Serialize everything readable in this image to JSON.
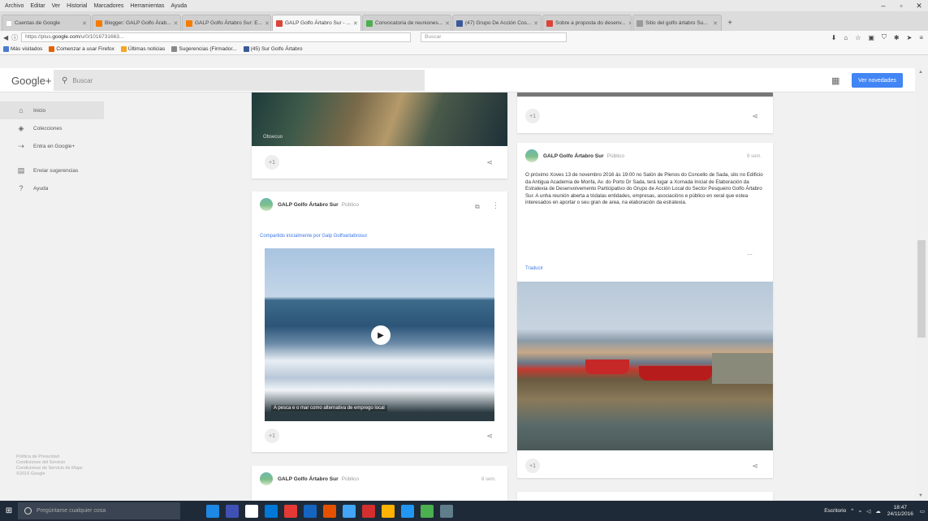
{
  "browser": {
    "menu": [
      "Archivo",
      "Editar",
      "Ver",
      "Historial",
      "Marcadores",
      "Herramientas",
      "Ayuda"
    ],
    "tabs": [
      {
        "title": "Cuentas de Google",
        "color": "#ffffff"
      },
      {
        "title": "Blogger: GALP Golfo Árab...",
        "color": "#f57c00"
      },
      {
        "title": "GALP Golfo Ártabro Sur: E...",
        "color": "#f57c00"
      },
      {
        "title": "GALP Golfo Ártabro Sur - ...",
        "color": "#db4437",
        "active": true
      },
      {
        "title": "Convocatoria de reuniones...",
        "color": "#4caf50"
      },
      {
        "title": "(47) Grupo De Acción Cos...",
        "color": "#3b5998"
      },
      {
        "title": "Sobre a proposta do desenv...",
        "color": "#db4437"
      },
      {
        "title": "Sitio del golfo ártabro Su...",
        "color": "#999999"
      }
    ],
    "url_prefix": "https://plus.",
    "url_domain": "google.com",
    "url_path": "/u/0/1016731663...",
    "search_placeholder": "Buscar",
    "bookmarks": [
      {
        "label": "Más visitados",
        "color": "#4a7bd0"
      },
      {
        "label": "Comenzar a usar Firefox",
        "color": "#e66000"
      },
      {
        "label": "Últimas noticias",
        "color": "#f5a623"
      },
      {
        "label": "Sugerencias (Firmador...",
        "color": "#888888"
      },
      {
        "label": "(45) Sur Golfo Ártabro",
        "color": "#3b5998"
      }
    ]
  },
  "gplus": {
    "logo": "Google+",
    "search_placeholder": "Buscar",
    "notifications_button": "Ver novedades",
    "sidebar": [
      {
        "label": "Inicio",
        "icon": "⌂",
        "name": "home",
        "active": true
      },
      {
        "label": "Colecciones",
        "icon": "◈",
        "name": "collections"
      },
      {
        "label": "Entra en Google+",
        "icon": "⇢",
        "name": "join"
      },
      {
        "label": "Enviar sugerencias",
        "icon": "▤",
        "name": "feedback"
      },
      {
        "label": "Ayuda",
        "icon": "?",
        "name": "help"
      }
    ],
    "sidebar_footer": [
      "Política de Privacidad",
      "Condiciones del Servicio",
      "Condiciones de Servicio de Maps",
      "©2016 Google"
    ],
    "posts": {
      "post1": {
        "image_caption": "Obsecuo"
      },
      "post2": {
        "author": "GALP Golfo Ártabro Sur",
        "visibility": "Público",
        "shared_text": "Compartido inicialmente por Galp Golfoartabrosur",
        "video_caption": "A pesca e o mar como alternativa de emprego local"
      },
      "post3": {
        "author": "GALP Golfo Ártabro Sur",
        "visibility": "Público",
        "timestamp": "8 sem.",
        "body": "O próximo Xoves 13 de novembro 2016 ás 19:00 no Salón de Plenos do Concello de Sada, sito no Edificio da Antigua Academia de Monfa, Av. do Porto Dr Sada, terá lugar a Xornada Inicial de Elaboración da Estratexia de Desenvolvemento Participativo do Grupo de Acción Local do Sector Pesqueiro Golfo Ártabro Sur. A unha reunión aberta a tódalas entidades, empresas, asociacións e público en xeral que estea interesados en aportar o seu gran de area, na elaboración da estratexia.",
        "translate": "Traducir"
      },
      "post4": {
        "author": "GALP Golfo Ártabro Sur",
        "visibility": "Público",
        "timestamp": "8 sem."
      }
    }
  },
  "taskbar": {
    "search_placeholder": "Pregúntame cualquier cosa",
    "apps": [
      "#1e88e5",
      "#3f51b5",
      "#ffffff",
      "#0078d7",
      "#e53935",
      "#1565c0",
      "#e65100",
      "#42a5f5",
      "#d32f2f",
      "#ffb300",
      "#2196f3",
      "#4caf50",
      "#607d8b"
    ],
    "tray_text": "Escritorio",
    "time": "18:47",
    "date": "24/11/2016"
  }
}
